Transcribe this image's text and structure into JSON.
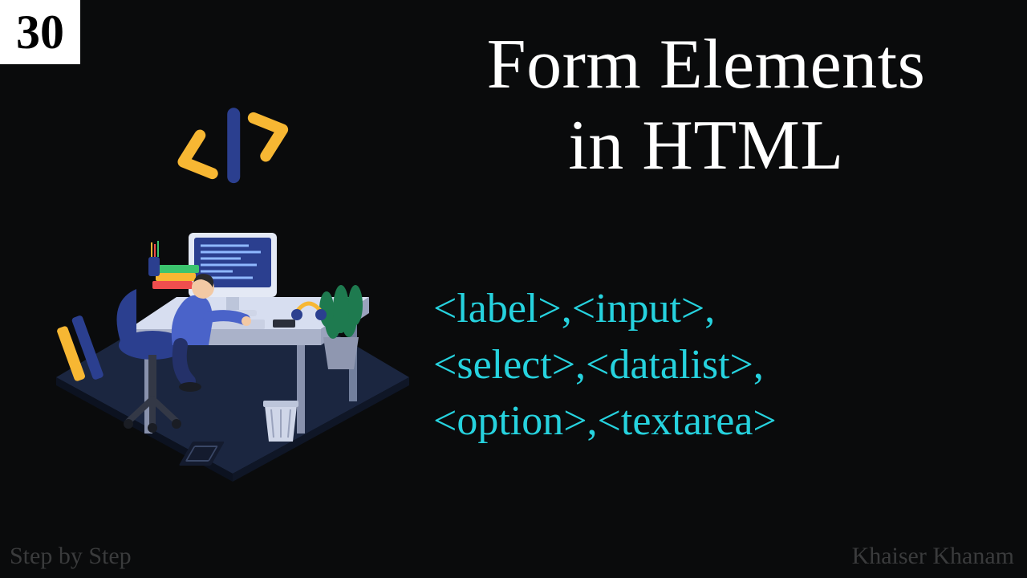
{
  "badge": {
    "number": "30"
  },
  "title": {
    "line1": "Form Elements",
    "line2": "in  HTML"
  },
  "tags": {
    "line1": "<label>,<input>,",
    "line2": "<select>,<datalist>,",
    "line3": "<option>,<textarea>"
  },
  "footer": {
    "left": "Step by Step",
    "right": "Khaiser Khanam"
  },
  "colors": {
    "bg": "#0a0b0c",
    "accent": "#26d2de",
    "white": "#ffffff",
    "muted": "#3a3b3c"
  }
}
